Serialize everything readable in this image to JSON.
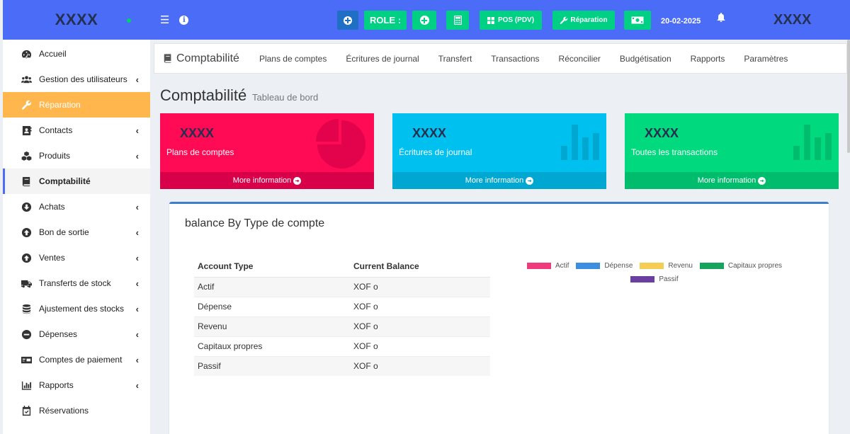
{
  "sidebar": {
    "brand": "XXXX",
    "items": [
      {
        "label": "Accueil",
        "icon": "dashboard-icon",
        "chevron": false
      },
      {
        "label": "Gestion des utilisateurs",
        "icon": "users-icon",
        "chevron": true
      },
      {
        "label": "Réparation",
        "icon": "wrench-icon",
        "chevron": false
      },
      {
        "label": "Contacts",
        "icon": "contact-book-icon",
        "chevron": true
      },
      {
        "label": "Produits",
        "icon": "cubes-icon",
        "chevron": true
      },
      {
        "label": "Comptabilité",
        "icon": "book-icon",
        "chevron": false
      },
      {
        "label": "Achats",
        "icon": "arrow-down-circle-icon",
        "chevron": true
      },
      {
        "label": "Bon de sortie",
        "icon": "arrow-up-circle-icon",
        "chevron": true
      },
      {
        "label": "Ventes",
        "icon": "arrow-up-circle-icon",
        "chevron": true
      },
      {
        "label": "Transferts de stock",
        "icon": "truck-icon",
        "chevron": true
      },
      {
        "label": "Ajustement des stocks",
        "icon": "database-icon",
        "chevron": true
      },
      {
        "label": "Dépenses",
        "icon": "minus-circle-icon",
        "chevron": true
      },
      {
        "label": "Comptes de paiement",
        "icon": "money-check-icon",
        "chevron": true
      },
      {
        "label": "Rapports",
        "icon": "bar-chart-icon",
        "chevron": true
      },
      {
        "label": "Réservations",
        "icon": "calendar-check-icon",
        "chevron": false
      }
    ],
    "chevron_glyph": "‹"
  },
  "topbar": {
    "menu_glyph": "☰",
    "info_glyph": "i",
    "role_label": "ROLE :",
    "pos_label": "POS (PDV)",
    "repair_label": "Réparation",
    "date": "20-02-2025",
    "user": "XXXX"
  },
  "tabs": {
    "title": "Comptabilité",
    "items": [
      "Plans de comptes",
      "Écritures de journal",
      "Transfert",
      "Transactions",
      "Réconcilier",
      "Budgétisation",
      "Rapports",
      "Paramètres"
    ]
  },
  "page": {
    "title": "Comptabilité",
    "subtitle": "Tableau de bord"
  },
  "cards": [
    {
      "value": "XXXX",
      "label": "Plans de comptes",
      "footer": "More information",
      "color": "#ff0a54"
    },
    {
      "value": "XXXX",
      "label": "Écritures de journal",
      "footer": "More information",
      "color": "#00c0ef"
    },
    {
      "value": "XXXX",
      "label": "Toutes les transactions",
      "footer": "More information",
      "color": "#00d97e"
    }
  ],
  "balance": {
    "title": "balance By Type de compte",
    "headers": [
      "Account Type",
      "Current Balance"
    ],
    "rows": [
      [
        "Actif",
        "XOF o"
      ],
      [
        "Dépense",
        "XOF o"
      ],
      [
        "Revenu",
        "XOF o"
      ],
      [
        "Capitaux propres",
        "XOF o"
      ],
      [
        "Passif",
        "XOF o"
      ]
    ]
  },
  "legend": [
    {
      "name": "Actif",
      "color": "#ef3b7c"
    },
    {
      "name": "Dépense",
      "color": "#3b8ee0"
    },
    {
      "name": "Revenu",
      "color": "#f5cd52"
    },
    {
      "name": "Capitaux propres",
      "color": "#15a35e"
    },
    {
      "name": "Passif",
      "color": "#6a3fa0"
    }
  ]
}
